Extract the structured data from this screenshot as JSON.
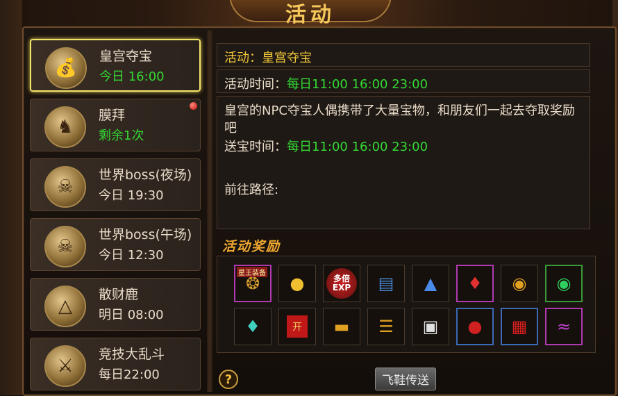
{
  "header": {
    "title": "活动"
  },
  "events": [
    {
      "name": "皇宫夺宝",
      "time": "今日 16:00",
      "time_color": "green",
      "icon": "treasure-chest-icon",
      "selected": true
    },
    {
      "name": "膜拜",
      "time": "剩余1次",
      "time_color": "green",
      "icon": "warrior-statue-icon",
      "badge": true
    },
    {
      "name": "世界boss(夜场)",
      "time": "今日 19:30",
      "time_color": "white",
      "icon": "boss-skull-icon"
    },
    {
      "name": "世界boss(午场)",
      "time": "今日 12:30",
      "time_color": "white",
      "icon": "boss-skull-icon"
    },
    {
      "name": "散财鹿",
      "time": "明日 08:00",
      "time_color": "white",
      "icon": "gold-ingot-icon"
    },
    {
      "name": "竞技大乱斗",
      "time": "每日22:00",
      "time_color": "white",
      "icon": "crossed-swords-icon"
    }
  ],
  "detail": {
    "activity_label": "活动：",
    "activity_name": "皇宫夺宝",
    "time_label": "活动时间：",
    "time_value": "每日11:00 16:00 23:00",
    "description": "皇宫的NPC夺宝人偶携带了大量宝物，和朋友们一起去夺取奖励吧",
    "delivery_label": "送宝时间：",
    "delivery_value": "每日11:00 16:00 23:00",
    "route_label": "前往路径:"
  },
  "rewards": {
    "title": "活动奖励",
    "first_item_tag": "星王装备",
    "exp_label": "多倍EXP",
    "packet_label": "开"
  },
  "buttons": {
    "teleport": "飞鞋传送",
    "help": "?"
  }
}
